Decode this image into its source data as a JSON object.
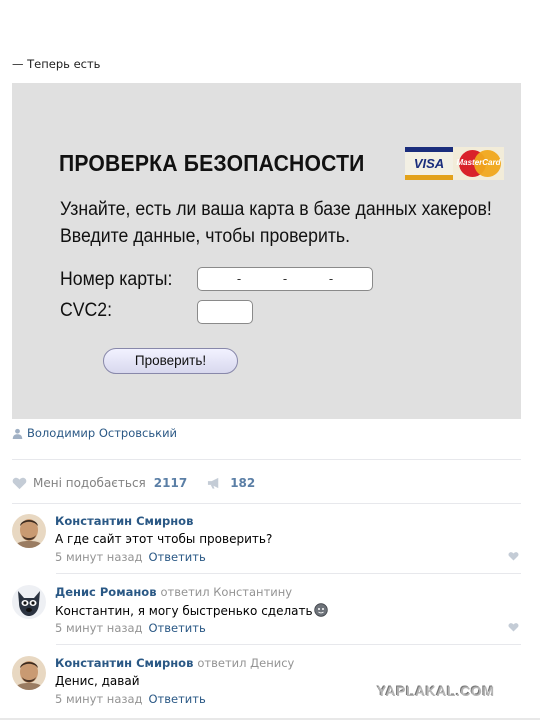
{
  "post": {
    "caption": "— Теперь есть"
  },
  "meme": {
    "title": "ПРОВЕРКА БЕЗОПАСНОСТИ",
    "card_logos": {
      "visa": "VISA",
      "mastercard": "MasterCard"
    },
    "line1": "Узнайте, есть ли ваша карта в базе данных хакеров!",
    "line2": "Введите данные, чтобы проверить.",
    "card_label": "Номер карты:",
    "card_placeholder_dashes": [
      "-",
      "-",
      "-"
    ],
    "cvc_label": "CVC2:",
    "button_label": "Проверить!"
  },
  "author": {
    "name": "Володимир Островський",
    "icon": "person-icon"
  },
  "stats": {
    "likes_label": "Мені подобається",
    "likes_count": "2117",
    "shares_count": "182",
    "like_icon": "heart-icon",
    "share_icon": "megaphone-icon"
  },
  "comments": [
    {
      "name": "Константин Смирнов",
      "replied_to": "",
      "text": "А где сайт этот чтобы проверить?",
      "time": "5 минут назад",
      "reply_label": "Ответить"
    },
    {
      "name": "Денис Романов",
      "replied_to": "ответил Константину",
      "text": "Константин, я могу быстренько сделать",
      "time": "5 минут назад",
      "reply_label": "Ответить"
    },
    {
      "name": "Константин Смирнов",
      "replied_to": "ответил Денису",
      "text": "Денис, давай",
      "time": "5 минут назад",
      "reply_label": "Ответить"
    }
  ],
  "watermark": "YAPLAKAL.COM",
  "colors": {
    "link": "#2a5885",
    "meta": "#939393",
    "meme_bg": "#e0e0e0"
  }
}
